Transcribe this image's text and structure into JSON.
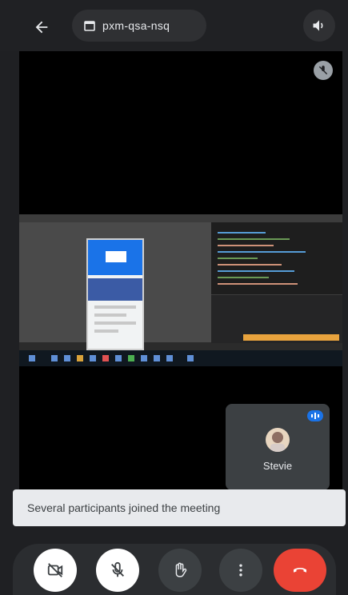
{
  "topbar": {
    "meeting_code": "pxm-qsa-nsq"
  },
  "self_tile": {
    "name": "Stevie"
  },
  "toast": {
    "message": "Several participants joined the meeting"
  },
  "controls": {
    "camera_icon": "camera-off-icon",
    "mic_icon": "mic-off-icon",
    "hand_icon": "raise-hand-icon",
    "more_icon": "more-vert-icon",
    "end_icon": "end-call-icon"
  },
  "colors": {
    "background": "#202124",
    "end_call": "#ea4335",
    "toast_bg": "#e8eaed",
    "accent": "#1a73e8"
  }
}
